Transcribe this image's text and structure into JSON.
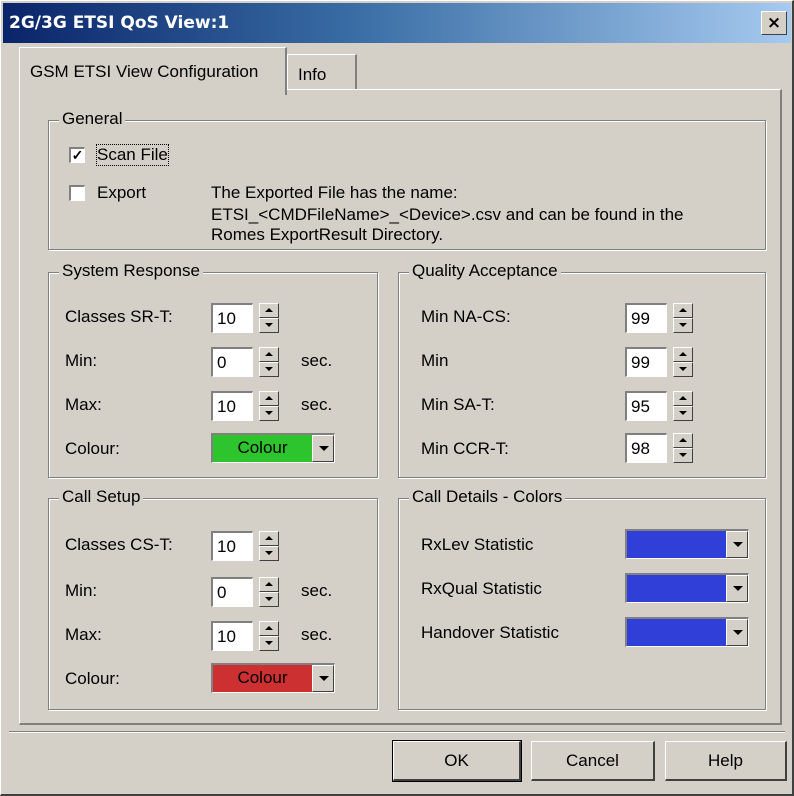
{
  "window": {
    "title": "2G/3G ETSI QoS View:1",
    "close_label": "×"
  },
  "tabs": [
    {
      "label": "GSM ETSI View Configuration",
      "active": true
    },
    {
      "label": "Info",
      "active": false
    }
  ],
  "general": {
    "title": "General",
    "scan_file": {
      "label": "Scan File",
      "checked": true,
      "mark": "✓"
    },
    "export": {
      "label": "Export",
      "checked": false
    },
    "export_info": [
      "The Exported File has the name:",
      "ETSI_<CMDFileName>_<Device>.csv and can be found in the",
      "Romes ExportResult Directory."
    ]
  },
  "system_response": {
    "title": "System Response",
    "classes_label": "Classes SR-T:",
    "classes_value": "10",
    "min_label": "Min:",
    "min_value": "0",
    "min_unit": "sec.",
    "max_label": "Max:",
    "max_value": "10",
    "max_unit": "sec.",
    "colour_label": "Colour:",
    "colour_value": "Colour",
    "colour_hex": "#2ec42e"
  },
  "call_setup": {
    "title": "Call Setup",
    "classes_label": "Classes CS-T:",
    "classes_value": "10",
    "min_label": "Min:",
    "min_value": "0",
    "min_unit": "sec.",
    "max_label": "Max:",
    "max_value": "10",
    "max_unit": "sec.",
    "colour_label": "Colour:",
    "colour_value": "Colour",
    "colour_hex": "#cc3030"
  },
  "quality_acceptance": {
    "title": "Quality Acceptance",
    "rows": [
      {
        "label": "Min NA-CS:",
        "value": "99"
      },
      {
        "label": "Min",
        "value": "99"
      },
      {
        "label": "Min SA-T:",
        "value": "95"
      },
      {
        "label": "Min CCR-T:",
        "value": "98"
      }
    ]
  },
  "call_details": {
    "title": "Call Details - Colors",
    "rows": [
      {
        "label": "RxLev Statistic",
        "colour_hex": "#2f3fd8"
      },
      {
        "label": "RxQual Statistic",
        "colour_hex": "#2f3fd8"
      },
      {
        "label": "Handover Statistic",
        "colour_hex": "#2f3fd8"
      }
    ]
  },
  "buttons": {
    "ok": "OK",
    "cancel": "Cancel",
    "help": "Help"
  }
}
